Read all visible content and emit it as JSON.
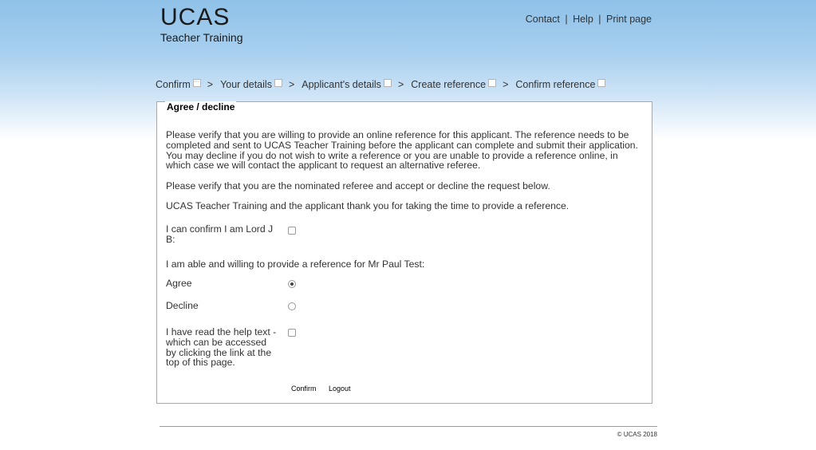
{
  "logo": {
    "brand": "UCAS",
    "sub": "Teacher Training"
  },
  "header": {
    "links": [
      "Contact",
      "Help",
      "Print page"
    ],
    "separator": "|"
  },
  "breadcrumb": {
    "items": [
      "Confirm",
      "Your details",
      "Applicant's details",
      "Create reference",
      "Confirm reference"
    ],
    "separator": ">"
  },
  "form": {
    "legend": "Agree / decline",
    "intro": "Please verify that you are willing to provide an online reference for this applicant. The reference needs to be completed and sent to UCAS Teacher Training before the applicant can complete and submit their application. You may decline if you do not wish to write a reference or you are unable to provide a reference online, in which case we will contact the applicant to request an alternative referee.",
    "verify_text": "Please verify that you are the nominated referee and accept or decline the request below.",
    "thanks_text": "UCAS Teacher Training and the applicant thank you for taking the time to provide a reference.",
    "confirm_identity_label": "I can confirm I am Lord J B:",
    "willing_label": "I am able and willing to provide a reference for Mr Paul Test:",
    "agree_label": "Agree",
    "decline_label": "Decline",
    "agree_selected": true,
    "help_label": "I have read the help text - which can be accessed by clicking the link at the top of this page.",
    "confirm_button": "Confirm",
    "logout_button": "Logout"
  },
  "footer": {
    "copyright": "© UCAS 2018"
  }
}
